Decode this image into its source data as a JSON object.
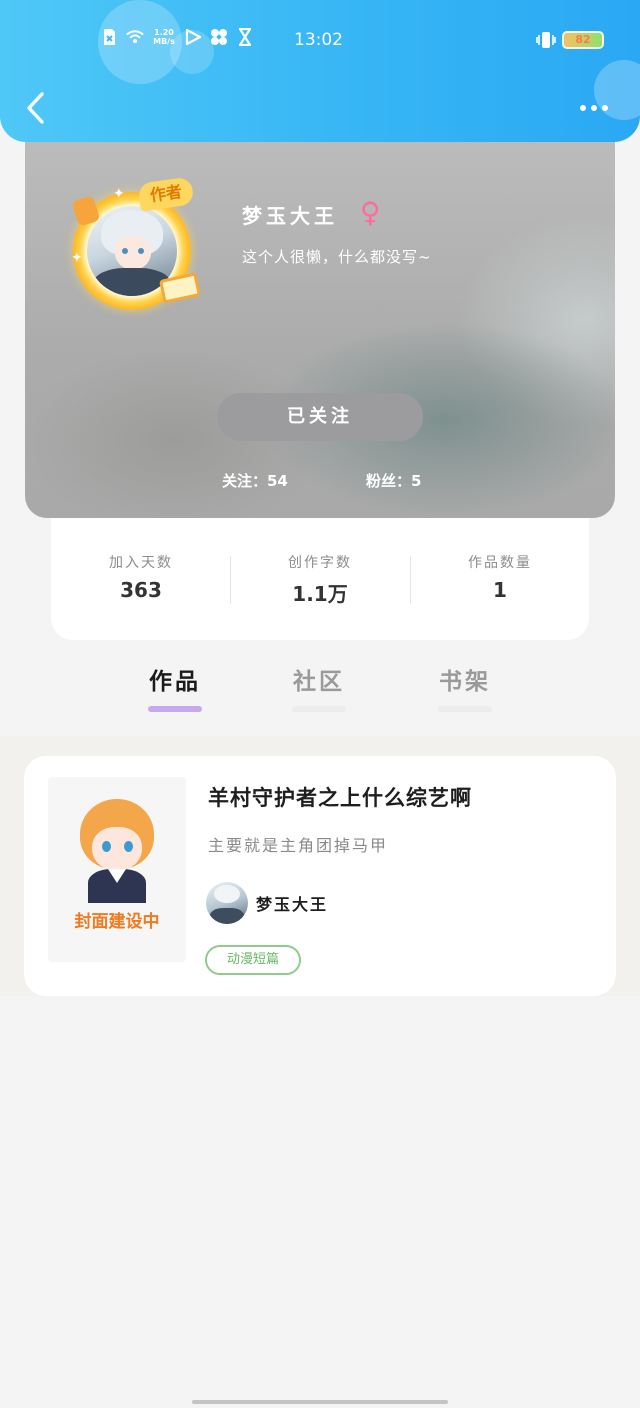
{
  "status_bar": {
    "net_speed_top": "1.20",
    "net_speed_bottom": "MB/s",
    "time": "13:02",
    "battery": "82",
    "icons": [
      "sim-x-icon",
      "wifi-icon",
      "play-icon",
      "pinwheel-icon",
      "hourglass-icon",
      "vibrate-icon",
      "battery-icon"
    ]
  },
  "header": {
    "back_icon": "chevron-left-icon",
    "more_icon": "more-dots-icon"
  },
  "profile": {
    "badge": "作者",
    "name": "梦玉大王",
    "gender_symbol": "♀",
    "bio": "这个人很懒，什么都没写~",
    "follow_button": "已关注",
    "following_label": "关注：54",
    "fans_label": "粉丝：5"
  },
  "stats": [
    {
      "label": "加入天数",
      "value": "363"
    },
    {
      "label": "创作字数",
      "value": "1.1万"
    },
    {
      "label": "作品数量",
      "value": "1"
    }
  ],
  "tabs": [
    {
      "label": "作品",
      "active": true
    },
    {
      "label": "社区",
      "active": false
    },
    {
      "label": "书架",
      "active": false
    }
  ],
  "works": [
    {
      "cover_text": "封面建设中",
      "title": "羊村守护者之上什么综艺啊",
      "description": "主要就是主角团掉马甲",
      "author": "梦玉大王",
      "tag": "动漫短篇"
    }
  ],
  "colors": {
    "header_gradient_start": "#4fc8f7",
    "header_gradient_end": "#2aa8f4",
    "tab_active_underline": "#c7a8ec",
    "gender_color": "#ff6b9a",
    "tag_green": "#68b865",
    "cover_text_orange": "#f07a1e"
  }
}
